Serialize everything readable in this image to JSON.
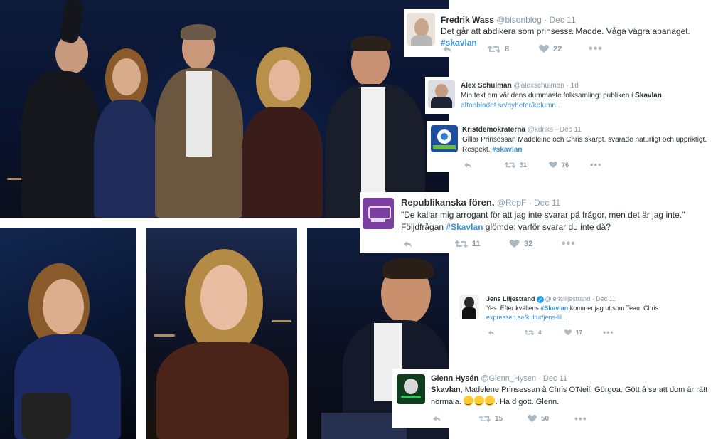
{
  "tweets": [
    {
      "name": "Fredrik Wass",
      "handle": "@bisonblog · Dec 11",
      "text_before": "Det går att abdikera som prinsessa Madde. Våga vägra apanaget.",
      "hashtag": "#skavlan",
      "retweets": "8",
      "likes": "22"
    },
    {
      "name": "Alex Schulman",
      "handle": "@alexschulman · 1d",
      "text_before": "Min text om världens dummaste folksamling: publiken i",
      "bold_word": "Skavlan",
      "text_after": ".",
      "link": "aftonbladet.se/nyheter/kolumn..."
    },
    {
      "name": "Kristdemokraterna",
      "handle": "@kdriks · Dec 11",
      "text_before": "Gillar Prinsessan Madeleine och Chris skarpt, svarade naturligt och uppriktigt. Respekt.",
      "hashtag": "#skavlan",
      "retweets": "31",
      "likes": "76"
    },
    {
      "name": "Republikanska fören.",
      "handle": "@RepF · Dec 11",
      "text_line1": "\"De kallar mig arrogant för att jag inte svarar på frågor, men det är jag inte.\"",
      "text_line2_before": "Följdfrågan",
      "hashtag": "#Skavlan",
      "text_line2_after": "glömde: varför svarar du inte då?",
      "retweets": "11",
      "likes": "32"
    },
    {
      "name": "Jens Liljestrand",
      "handle": "@jensliljestrand · Dec 11",
      "text_before": "Yes. Efter kvällens",
      "hashtag": "#Skavlan",
      "text_after": "kommer jag ut som Team Chris.",
      "link": "expressen.se/kultur/jens-lil...",
      "retweets": "4",
      "likes": "17"
    },
    {
      "name": "Glenn Hysén",
      "handle": "@Glenn_Hysen · Dec 11",
      "bold_word": "Skavlan",
      "text_after": ", Madelene Prinsessan å Chris O'Neil, Görgoa. Gött å se att dom är rätt",
      "text_line2_before": "normala.",
      "text_line2_after": ". Ha d gott. Glenn.",
      "retweets": "15",
      "likes": "50"
    }
  ],
  "icons": {
    "reply": "reply-icon",
    "retweet": "retweet-icon",
    "like": "heart-icon",
    "more": "more-icon"
  },
  "colors": {
    "hashtag": "#3b94d9",
    "handle": "#8899a6",
    "action": "#aab8c2"
  }
}
